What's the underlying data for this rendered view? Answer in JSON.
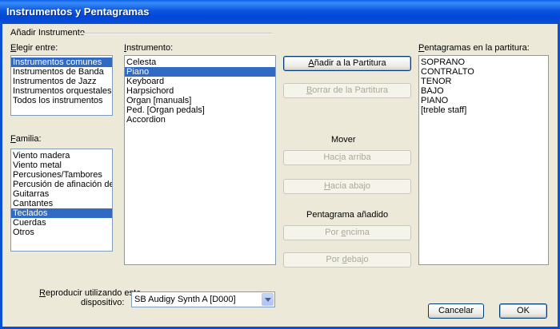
{
  "window": {
    "title": "Instrumentos y Pentagramas"
  },
  "group": {
    "label": "Añadir Instrumento"
  },
  "choose": {
    "label_key": "E",
    "label_rest": "legir entre:",
    "items": [
      "Instrumentos comunes",
      "Instrumentos de Banda",
      "Instrumentos de Jazz",
      "Instrumentos orquestales",
      "Todos los instrumentos"
    ],
    "selected_index": 0
  },
  "family": {
    "label_key": "F",
    "label_rest": "amilia:",
    "items": [
      "Viento madera",
      "Viento metal",
      "Percusiones/Tambores",
      "Percusión de afinación deter",
      "Guitarras",
      "Cantantes",
      "Teclados",
      "Cuerdas",
      "Otros"
    ],
    "selected_index": 6
  },
  "instrument": {
    "label_key": "I",
    "label_rest": "nstrumento:",
    "items": [
      "Celesta",
      "Piano",
      "Keyboard",
      "Harpsichord",
      "Organ [manuals]",
      "Ped. [Organ pedals]",
      "Accordion"
    ],
    "selected_index": 1
  },
  "buttons": {
    "add_key": "A",
    "add_rest": "ñadir a la Partitura",
    "remove_key": "B",
    "remove_rest": "orrar de la Partitura",
    "up_pre": "Hac",
    "up_key": "i",
    "up_post": "a arriba",
    "down_key": "H",
    "down_rest": "acia abajo",
    "above_pre": "Por ",
    "above_key": "e",
    "above_post": "ncima",
    "below_pre": "Por ",
    "below_key": "d",
    "below_post": "ebajo",
    "cancel": "Cancelar",
    "ok": "OK"
  },
  "move_label": "Mover",
  "added_staff_label": "Pentagrama añadido",
  "score": {
    "label_key": "P",
    "label_rest": "entagramas en la partitura:",
    "items": [
      "SOPRANO",
      "CONTRALTO",
      "TENOR",
      "BAJO",
      "PIANO",
      "[treble staff]"
    ]
  },
  "device": {
    "label_line1_pre": "",
    "label_line1_key": "R",
    "label_line1_post": "eproducir utilizando este",
    "label_line2": "dispositivo:",
    "value": "SB Audigy Synth A [D000]"
  }
}
